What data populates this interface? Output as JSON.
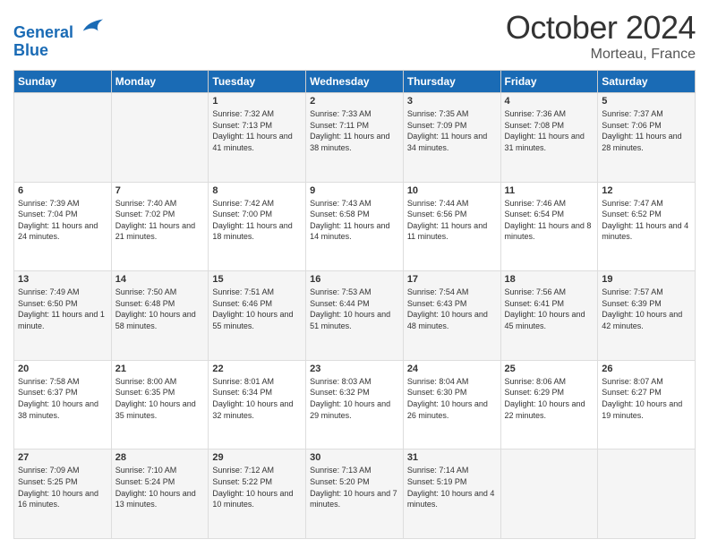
{
  "header": {
    "logo_line1": "General",
    "logo_line2": "Blue",
    "month": "October 2024",
    "location": "Morteau, France"
  },
  "days_of_week": [
    "Sunday",
    "Monday",
    "Tuesday",
    "Wednesday",
    "Thursday",
    "Friday",
    "Saturday"
  ],
  "weeks": [
    [
      {
        "day": "",
        "info": ""
      },
      {
        "day": "",
        "info": ""
      },
      {
        "day": "1",
        "info": "Sunrise: 7:32 AM\nSunset: 7:13 PM\nDaylight: 11 hours and 41 minutes."
      },
      {
        "day": "2",
        "info": "Sunrise: 7:33 AM\nSunset: 7:11 PM\nDaylight: 11 hours and 38 minutes."
      },
      {
        "day": "3",
        "info": "Sunrise: 7:35 AM\nSunset: 7:09 PM\nDaylight: 11 hours and 34 minutes."
      },
      {
        "day": "4",
        "info": "Sunrise: 7:36 AM\nSunset: 7:08 PM\nDaylight: 11 hours and 31 minutes."
      },
      {
        "day": "5",
        "info": "Sunrise: 7:37 AM\nSunset: 7:06 PM\nDaylight: 11 hours and 28 minutes."
      }
    ],
    [
      {
        "day": "6",
        "info": "Sunrise: 7:39 AM\nSunset: 7:04 PM\nDaylight: 11 hours and 24 minutes."
      },
      {
        "day": "7",
        "info": "Sunrise: 7:40 AM\nSunset: 7:02 PM\nDaylight: 11 hours and 21 minutes."
      },
      {
        "day": "8",
        "info": "Sunrise: 7:42 AM\nSunset: 7:00 PM\nDaylight: 11 hours and 18 minutes."
      },
      {
        "day": "9",
        "info": "Sunrise: 7:43 AM\nSunset: 6:58 PM\nDaylight: 11 hours and 14 minutes."
      },
      {
        "day": "10",
        "info": "Sunrise: 7:44 AM\nSunset: 6:56 PM\nDaylight: 11 hours and 11 minutes."
      },
      {
        "day": "11",
        "info": "Sunrise: 7:46 AM\nSunset: 6:54 PM\nDaylight: 11 hours and 8 minutes."
      },
      {
        "day": "12",
        "info": "Sunrise: 7:47 AM\nSunset: 6:52 PM\nDaylight: 11 hours and 4 minutes."
      }
    ],
    [
      {
        "day": "13",
        "info": "Sunrise: 7:49 AM\nSunset: 6:50 PM\nDaylight: 11 hours and 1 minute."
      },
      {
        "day": "14",
        "info": "Sunrise: 7:50 AM\nSunset: 6:48 PM\nDaylight: 10 hours and 58 minutes."
      },
      {
        "day": "15",
        "info": "Sunrise: 7:51 AM\nSunset: 6:46 PM\nDaylight: 10 hours and 55 minutes."
      },
      {
        "day": "16",
        "info": "Sunrise: 7:53 AM\nSunset: 6:44 PM\nDaylight: 10 hours and 51 minutes."
      },
      {
        "day": "17",
        "info": "Sunrise: 7:54 AM\nSunset: 6:43 PM\nDaylight: 10 hours and 48 minutes."
      },
      {
        "day": "18",
        "info": "Sunrise: 7:56 AM\nSunset: 6:41 PM\nDaylight: 10 hours and 45 minutes."
      },
      {
        "day": "19",
        "info": "Sunrise: 7:57 AM\nSunset: 6:39 PM\nDaylight: 10 hours and 42 minutes."
      }
    ],
    [
      {
        "day": "20",
        "info": "Sunrise: 7:58 AM\nSunset: 6:37 PM\nDaylight: 10 hours and 38 minutes."
      },
      {
        "day": "21",
        "info": "Sunrise: 8:00 AM\nSunset: 6:35 PM\nDaylight: 10 hours and 35 minutes."
      },
      {
        "day": "22",
        "info": "Sunrise: 8:01 AM\nSunset: 6:34 PM\nDaylight: 10 hours and 32 minutes."
      },
      {
        "day": "23",
        "info": "Sunrise: 8:03 AM\nSunset: 6:32 PM\nDaylight: 10 hours and 29 minutes."
      },
      {
        "day": "24",
        "info": "Sunrise: 8:04 AM\nSunset: 6:30 PM\nDaylight: 10 hours and 26 minutes."
      },
      {
        "day": "25",
        "info": "Sunrise: 8:06 AM\nSunset: 6:29 PM\nDaylight: 10 hours and 22 minutes."
      },
      {
        "day": "26",
        "info": "Sunrise: 8:07 AM\nSunset: 6:27 PM\nDaylight: 10 hours and 19 minutes."
      }
    ],
    [
      {
        "day": "27",
        "info": "Sunrise: 7:09 AM\nSunset: 5:25 PM\nDaylight: 10 hours and 16 minutes."
      },
      {
        "day": "28",
        "info": "Sunrise: 7:10 AM\nSunset: 5:24 PM\nDaylight: 10 hours and 13 minutes."
      },
      {
        "day": "29",
        "info": "Sunrise: 7:12 AM\nSunset: 5:22 PM\nDaylight: 10 hours and 10 minutes."
      },
      {
        "day": "30",
        "info": "Sunrise: 7:13 AM\nSunset: 5:20 PM\nDaylight: 10 hours and 7 minutes."
      },
      {
        "day": "31",
        "info": "Sunrise: 7:14 AM\nSunset: 5:19 PM\nDaylight: 10 hours and 4 minutes."
      },
      {
        "day": "",
        "info": ""
      },
      {
        "day": "",
        "info": ""
      }
    ]
  ]
}
